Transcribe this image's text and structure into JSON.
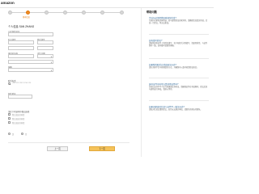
{
  "header": {
    "logo_text": "amazon"
  },
  "steps": {
    "labels": [
      "",
      "基本信息",
      "",
      "",
      "",
      "",
      ""
    ],
    "active_index": 1
  },
  "form": {
    "section_title": "个人信息 SAN ZHANG",
    "fields": [
      {
        "label": "公民身份证号",
        "value": ""
      },
      {
        "label": "名字拼音",
        "value": ""
      },
      {
        "label": "姓氏拼音",
        "value": ""
      },
      {
        "label": "身份证号码",
        "value": ""
      },
      {
        "label": "出生日期",
        "value": ""
      }
    ],
    "country_label": "国籍",
    "phone_label": "联系电话",
    "phone_hint": "+86 123 1232 1234 123",
    "sms_label": "短信验证",
    "radio_options": [
      "是",
      "否"
    ],
    "checkbox_options": [
      "我已阅读并同意",
      "我已阅读并同意",
      "我已阅读并同意"
    ],
    "consent_label": "请在下列选项中做出选择",
    "prev_button": "上一页",
    "next_button": "下一页"
  },
  "help": {
    "title": "帮助问题",
    "items": [
      {
        "q": "为什么必须提供卖家身份信息?",
        "a": "为保护买家和卖家利益，亚马逊需验证卖家身份，请确保信息真实有效，信息一旦提交，将无法更改。"
      },
      {
        "q": "如何填写姓名?",
        "a": "请按照身份证件上的姓名填写，名字和姓氏分别填写，请使用拼音，与证件保持一致，如有疑问请联系客服。"
      },
      {
        "q": "如果我的联系方式变更怎么办?",
        "a": "请在卖家平台中更新联系方式，并确保可以及时收到验证短信。"
      },
      {
        "q": "身份证件号码可以是其他证件吗?",
        "a": "目前仅支持中华人民共和国居民身份证，请确保证件在有效期内，提交后亚马逊将进行审核，请耐心等待。"
      },
      {
        "q": "如果卖家身份信息与证件不一致怎么办?",
        "a": "请核对信息后重新提交，如仍无法通过审核，请联系卖家支持团队。"
      }
    ]
  },
  "colors": {
    "accent": "#f08a24",
    "next_button": "#f5c35a",
    "link": "#2a6496"
  }
}
